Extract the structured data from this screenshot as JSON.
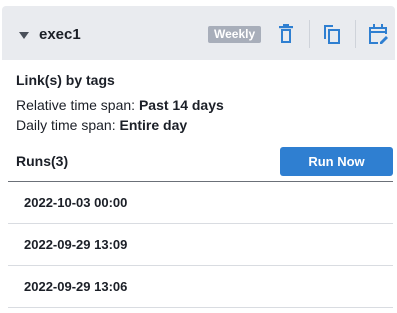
{
  "exec": {
    "name": "exec1",
    "schedule_badge": "Weekly",
    "link_mode": "Link(s) by tags",
    "relative_span_label": "Relative time span:",
    "relative_span_value": "Past 14 days",
    "daily_span_label": "Daily time span:",
    "daily_span_value": "Entire day"
  },
  "toolbar": {
    "icons": [
      "trash-icon",
      "copy-icon",
      "edit-calendar-icon"
    ]
  },
  "runs": {
    "title": "Runs(3)",
    "run_now_label": "Run Now",
    "items": [
      {
        "label": "2022-10-03 00:00"
      },
      {
        "label": "2022-09-29 13:09"
      },
      {
        "label": "2022-09-29 13:06"
      }
    ]
  },
  "colors": {
    "header_bg": "#e9ebef",
    "accent": "#2f7fd1",
    "icon_blue": "#2f7fd1",
    "badge_bg": "#a8aeba"
  }
}
